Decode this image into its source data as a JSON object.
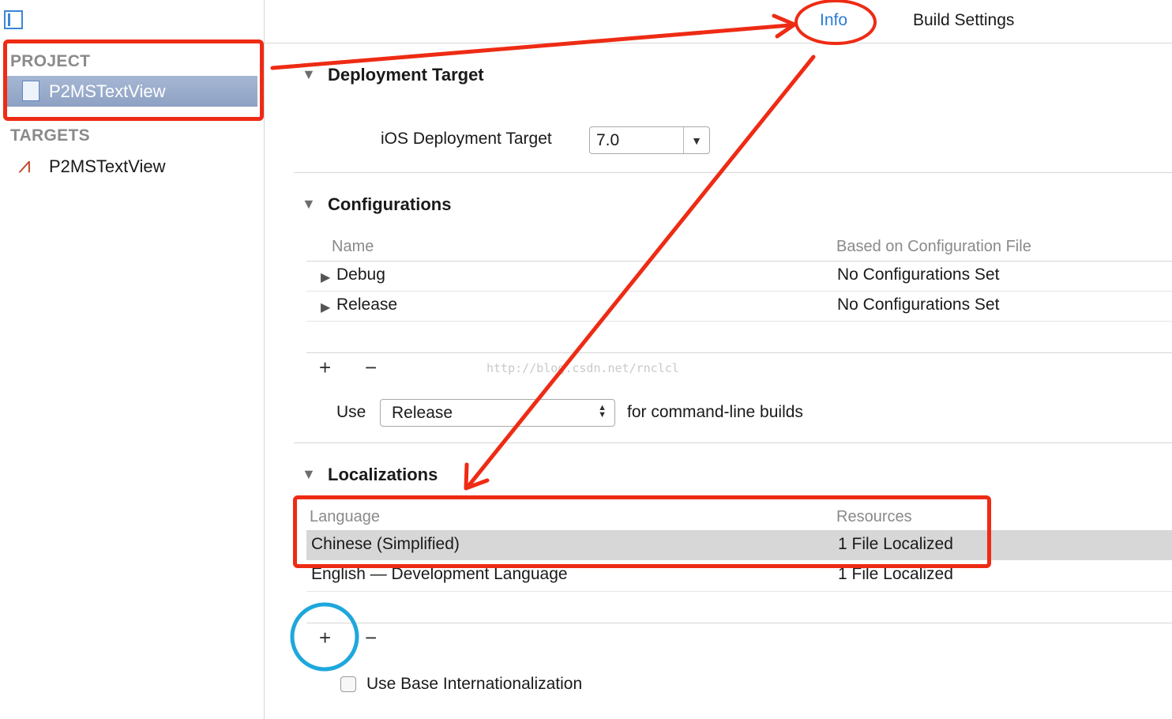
{
  "sidebar": {
    "project_header": "PROJECT",
    "project_item": "P2MSTextView",
    "targets_header": "TARGETS",
    "target_item": "P2MSTextView"
  },
  "tabs": {
    "info": "Info",
    "build_settings": "Build Settings"
  },
  "deployment": {
    "title": "Deployment Target",
    "ios_label": "iOS Deployment Target",
    "ios_value": "7.0"
  },
  "configurations": {
    "title": "Configurations",
    "col_name": "Name",
    "col_file": "Based on Configuration File",
    "rows": [
      {
        "name": "Debug",
        "file": "No Configurations Set"
      },
      {
        "name": "Release",
        "file": "No Configurations Set"
      }
    ],
    "add": "+",
    "remove": "−",
    "use_label": "Use",
    "use_value": "Release",
    "use_suffix": "for command-line builds"
  },
  "watermark": "http://blog.csdn.net/rnclcl",
  "localizations": {
    "title": "Localizations",
    "col_language": "Language",
    "col_resources": "Resources",
    "rows": [
      {
        "language": "Chinese (Simplified)",
        "resources": "1 File Localized"
      },
      {
        "language": "English — Development Language",
        "resources": "1 File Localized"
      }
    ],
    "add": "+",
    "remove": "−",
    "base_checkbox_label": "Use Base Internationalization"
  },
  "colors": {
    "annotation_red": "#ee2b14",
    "annotation_blue": "#1ea7dc",
    "tab_selected": "#2a7bd8",
    "project_highlight": "#98abcb"
  }
}
